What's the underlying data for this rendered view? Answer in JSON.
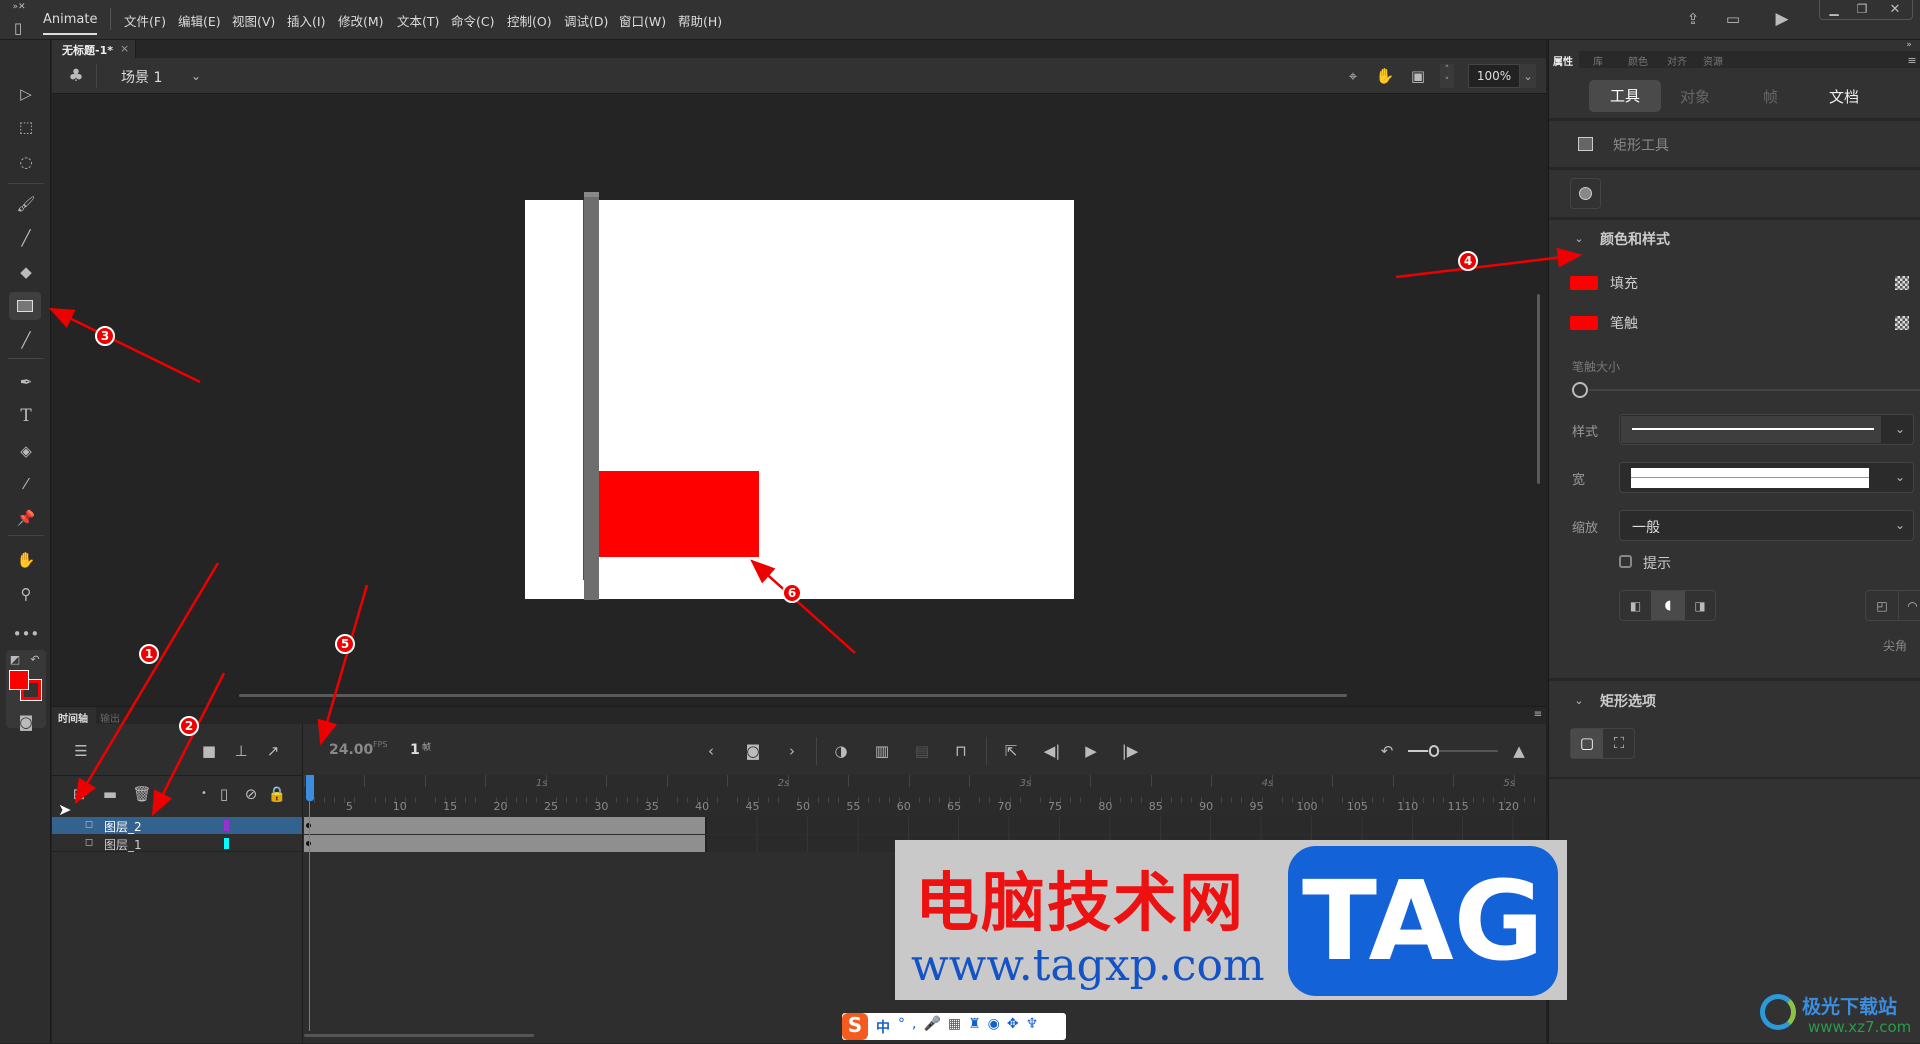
{
  "app": {
    "name": "Animate",
    "menus": [
      "文件(F)",
      "编辑(E)",
      "视图(V)",
      "插入(I)",
      "修改(M)",
      "文本(T)",
      "命令(C)",
      "控制(O)",
      "调试(D)",
      "窗口(W)",
      "帮助(H)"
    ]
  },
  "document": {
    "tab_title": "无标题-1*",
    "close": "×"
  },
  "scene": {
    "label": "场景 1",
    "zoom": "100%"
  },
  "colors": {
    "fill": "#ff0000",
    "stroke": "#ff0000",
    "accent": "#3b8de0",
    "selected_layer": "#34628f"
  },
  "timeline": {
    "tabs": [
      "时间轴",
      "输出"
    ],
    "fps": "24.00",
    "fps_unit": "FPS",
    "current_frame": "1",
    "frame_unit": "帧",
    "frame_ticks": [
      "5",
      "10",
      "15",
      "20",
      "25",
      "30",
      "35",
      "40",
      "45",
      "50",
      "55",
      "60",
      "65",
      "70",
      "75",
      "80",
      "85",
      "90",
      "95",
      "100",
      "105",
      "110",
      "115",
      "120"
    ],
    "second_ticks": [
      "1s",
      "2s",
      "3s",
      "4s",
      "5s"
    ],
    "layers": [
      {
        "name": "图层_2",
        "color": "#9b30d0",
        "selected": true,
        "frames": 40
      },
      {
        "name": "图层_1",
        "color": "#00ffff",
        "selected": false,
        "frames": 40
      }
    ]
  },
  "properties": {
    "tabs": [
      "属性",
      "库",
      "颜色",
      "对齐",
      "资源"
    ],
    "subtabs": [
      "工具",
      "对象",
      "帧",
      "文档"
    ],
    "active_subtab": "工具",
    "tool_name": "矩形工具",
    "color_section": "颜色和样式",
    "fill_label": "填充",
    "stroke_label": "笔触",
    "stroke_size_label": "笔触大小",
    "style_label": "样式",
    "width_label": "宽",
    "scale_label": "缩放",
    "scale_value": "一般",
    "hint_label": "提示",
    "hint_checked": false,
    "join_label": "尖角",
    "rect_section": "矩形选项"
  },
  "annotations": [
    "1",
    "2",
    "3",
    "4",
    "5",
    "6"
  ],
  "watermark": {
    "site_name": "电脑技术网",
    "url": "www.tagxp.com",
    "badge": "TAG",
    "corner_logo": "极光下载站",
    "corner_url": "www.xz7.com"
  },
  "ime": {
    "label": "中"
  }
}
